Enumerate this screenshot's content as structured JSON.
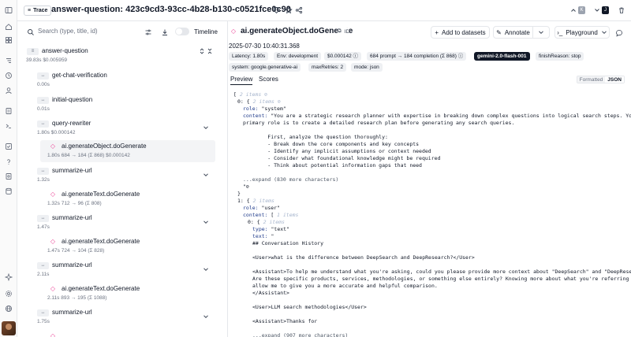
{
  "header": {
    "badge": "Trace",
    "title": "answer-question: 423c9cd3-93cc-4b28-b130-c0521fce0c90",
    "kbd_up": "K",
    "kbd_down": "J"
  },
  "rail_icons": [
    "sidebar-toggle-icon",
    "home-icon",
    "dashboard-icon",
    "traces-icon",
    "sessions-icon",
    "users-icon",
    "prompts-icon",
    "scores-icon",
    "playground-icon",
    "datasets-icon",
    "settings-icon",
    "help-icon",
    "support-icon",
    "storage-icon",
    "sparkle-icon",
    "settings-gear-icon",
    "globe-icon"
  ],
  "left": {
    "search_placeholder": "Search (type, title, id)",
    "timeline_label": "Timeline",
    "nodes": [
      {
        "type": "trace",
        "name": "answer-question",
        "meta": "39.83s  $0.005959"
      },
      {
        "type": "span",
        "name": "get-chat-verification",
        "meta": "0.00s"
      },
      {
        "type": "span",
        "name": "initial-question",
        "meta": "0.01s"
      },
      {
        "type": "span",
        "name": "query-rewriter",
        "meta": "1.80s  $0.000142"
      },
      {
        "type": "generation",
        "name": "ai.generateObject.doGenerate",
        "meta": "1.80s  684 → 184 (Σ 868)  $0.000142"
      },
      {
        "type": "span",
        "name": "summarize-url",
        "meta": "1.32s"
      },
      {
        "type": "generation",
        "name": "ai.generateText.doGenerate",
        "meta": "1.32s  712 → 96 (Σ 808)"
      },
      {
        "type": "span",
        "name": "summarize-url",
        "meta": "1.47s"
      },
      {
        "type": "generation",
        "name": "ai.generateText.doGenerate",
        "meta": "1.47s  724 → 104 (Σ 828)"
      },
      {
        "type": "span",
        "name": "summarize-url",
        "meta": "2.11s"
      },
      {
        "type": "generation",
        "name": "ai.generateText.doGenerate",
        "meta": "2.11s  893 → 195 (Σ 1088)"
      },
      {
        "type": "span",
        "name": "summarize-url",
        "meta": "1.75s"
      }
    ],
    "type_labels": {
      "span": "↔",
      "trace": "≡"
    }
  },
  "right": {
    "title": "ai.generateObject.doGenerate",
    "id_label": "ID",
    "buttons": {
      "add_to_datasets": "Add to datasets",
      "annotate": "Annotate",
      "playground": "Playground"
    },
    "timestamp": "2025-07-30 10:40:31.368",
    "tags_row1": [
      "Latency: 1.80s",
      "Env: development",
      "$0.000142",
      "684 prompt → 184 completion (Σ 868)",
      "gemini-2.0-flash-001",
      "finishReason: stop"
    ],
    "tags_row2": [
      "system: google.generative-ai",
      "maxRetries: 2",
      "mode: json"
    ],
    "tabs": [
      "Preview",
      "Scores"
    ],
    "format": {
      "formatted": "Formatted",
      "json": "JSON"
    },
    "json_lines": [
      {
        "i": 0,
        "t": "[",
        "m": " 2 items ",
        "c": "⊘"
      },
      {
        "i": 1,
        "t": "0: {",
        "m": " 2 items ",
        "c": "⊘"
      },
      {
        "i": 2,
        "k": "role:",
        "v": " \"system\""
      },
      {
        "i": 2,
        "k": "content:",
        "v": " \"You are a strategic research planner with expertise in breaking down complex questions into logical search steps. Your"
      },
      {
        "i": 2,
        "v": "primary role is to create a detailed research plan before generating any search queries."
      },
      {
        "i": 2,
        "v": ""
      },
      {
        "i": 2,
        "v": "        First, analyze the question thoroughly:"
      },
      {
        "i": 2,
        "v": "        - Break down the core components and key concepts"
      },
      {
        "i": 2,
        "v": "        - Identify any implicit assumptions or context needed"
      },
      {
        "i": 2,
        "v": "        - Consider what foundational knowledge might be required"
      },
      {
        "i": 2,
        "v": "        - Think about potential information gaps that need"
      },
      {
        "i": 2,
        "v": ""
      },
      {
        "i": 2,
        "x": "...expand (830 more characters)"
      },
      {
        "i": 2,
        "v": "\"⊘"
      },
      {
        "i": 1,
        "t": "}"
      },
      {
        "i": 1,
        "t": "1: {",
        "m": " 2 items "
      },
      {
        "i": 2,
        "k": "role:",
        "v": " \"user\""
      },
      {
        "i": 2,
        "k": "content:",
        "v": " [",
        "m": " 1 items "
      },
      {
        "i": 3,
        "t": "0: {",
        "m": " 2 items "
      },
      {
        "i": 4,
        "k": "type:",
        "v": " \"text\""
      },
      {
        "i": 4,
        "k": "text:",
        "v": " \""
      },
      {
        "i": 4,
        "v": "## Conversation History"
      },
      {
        "i": 4,
        "v": ""
      },
      {
        "i": 4,
        "v": "<User>what is the difference between DeepSearch and DeepResearch?</User>"
      },
      {
        "i": 4,
        "v": ""
      },
      {
        "i": 4,
        "v": "<Assistant>To help me understand what you're asking, could you please provide more context about \"DeepSearch\" and \"DeepResearch\"?"
      },
      {
        "i": 4,
        "v": "Are these specific products, services, methodologies, or something else entirely? Knowing more about what you're referring to will"
      },
      {
        "i": 4,
        "v": "allow me to give you a more accurate and helpful comparison."
      },
      {
        "i": 4,
        "v": "</Assistant>"
      },
      {
        "i": 4,
        "v": ""
      },
      {
        "i": 4,
        "v": "<User>LLM search methodologies</User>"
      },
      {
        "i": 4,
        "v": ""
      },
      {
        "i": 4,
        "v": "<Assistant>Thanks for"
      },
      {
        "i": 4,
        "v": ""
      },
      {
        "i": 4,
        "x": "...expand (907 more characters)"
      }
    ]
  }
}
